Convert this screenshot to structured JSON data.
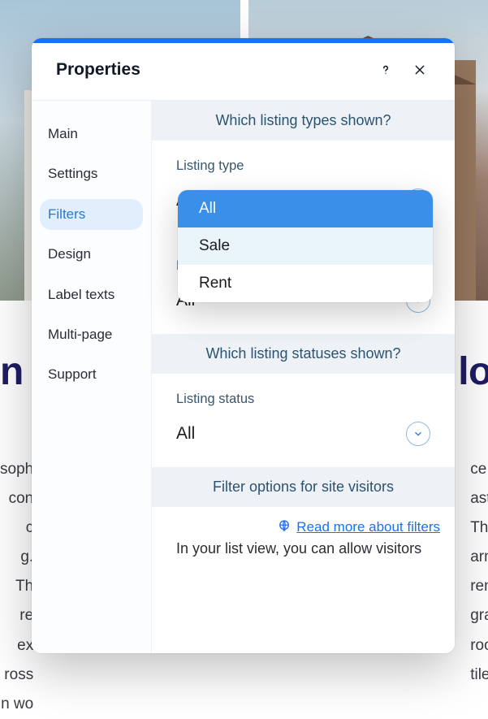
{
  "background": {
    "heading_fragment_left": "n G",
    "heading_fragment_right": "los",
    "col1_frag": "soph\ncon c\ng. Th\nre ex\nross\nn wo",
    "col2_frag": "ce w\naste\nThis\narm\nreng\ngrad\nroof tiles."
  },
  "modal": {
    "title": "Properties",
    "sidebar": {
      "items": [
        {
          "label": "Main",
          "active": false
        },
        {
          "label": "Settings",
          "active": false
        },
        {
          "label": "Filters",
          "active": true
        },
        {
          "label": "Design",
          "active": false
        },
        {
          "label": "Label texts",
          "active": false
        },
        {
          "label": "Multi-page",
          "active": false
        },
        {
          "label": "Support",
          "active": false
        }
      ]
    },
    "sections": {
      "listing_types": {
        "heading": "Which listing types shown?",
        "listing_type_label": "Listing type",
        "listing_type_value": "All",
        "property_type_label": "Property type",
        "property_type_value": "All"
      },
      "listing_statuses": {
        "heading": "Which listing statuses shown?",
        "listing_status_label": "Listing status",
        "listing_status_value": "All"
      },
      "filter_options": {
        "heading": "Filter options for site visitors",
        "read_more": "Read more about filters",
        "body_note": "In your list view, you can allow visitors"
      }
    },
    "dropdown": {
      "options": [
        {
          "label": "All",
          "state": "selected"
        },
        {
          "label": "Sale",
          "state": "hover"
        },
        {
          "label": "Rent",
          "state": ""
        }
      ]
    }
  }
}
